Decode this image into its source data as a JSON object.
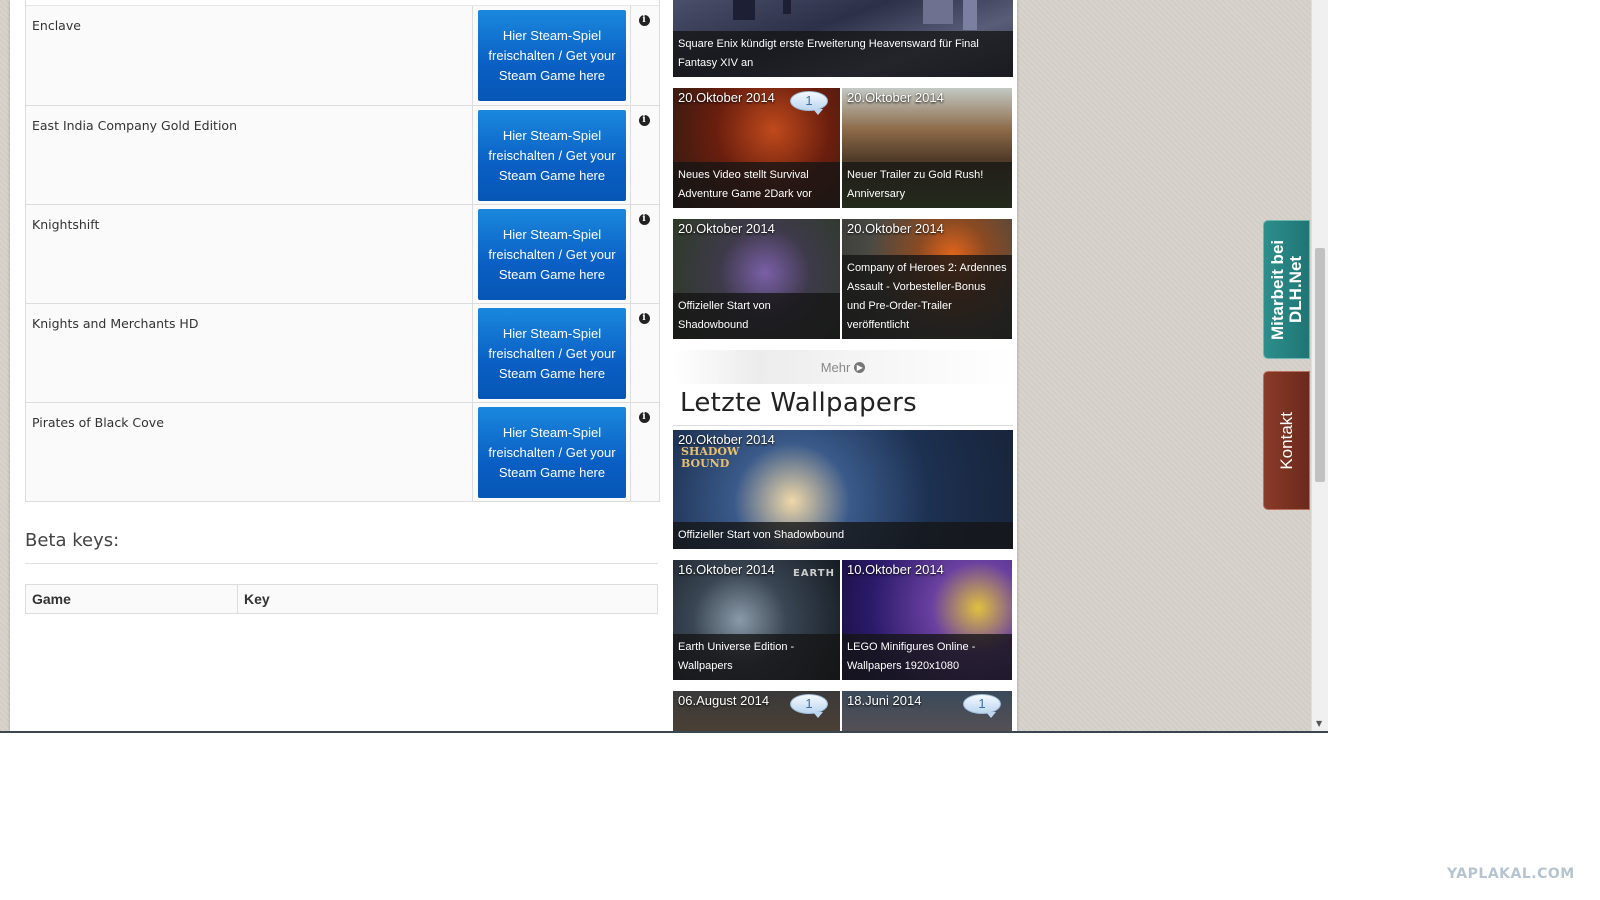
{
  "steam_rows": [
    {
      "name": "Enclave",
      "button": "Hier Steam-Spiel freischalten / Get your Steam Game here"
    },
    {
      "name": "East India Company Gold Edition",
      "button": "Hier Steam-Spiel freischalten / Get your Steam Game here"
    },
    {
      "name": "Knightshift",
      "button": "Hier Steam-Spiel freischalten / Get your Steam Game here"
    },
    {
      "name": "Knights and Merchants HD",
      "button": "Hier Steam-Spiel freischalten / Get your Steam Game here"
    },
    {
      "name": "Pirates of Black Cove",
      "button": "Hier Steam-Spiel freischalten / Get your Steam Game here"
    }
  ],
  "beta": {
    "title": "Beta keys:",
    "col_game": "Game",
    "col_key": "Key"
  },
  "news": {
    "top_caption": "Square Enix kündigt erste Erweiterung Heavensward für Final Fantasy XIV an",
    "tiles": [
      {
        "date": "20.Oktober 2014",
        "caption": "Neues Video stellt Survival Adventure Game 2Dark vor",
        "comments": "1"
      },
      {
        "date": "20.Oktober 2014",
        "caption": "Neuer Trailer zu Gold Rush! Anniversary"
      },
      {
        "date": "20.Oktober 2014",
        "caption": "Offizieller Start von Shadowbound"
      },
      {
        "date": "20.Oktober 2014",
        "caption": "Company of Heroes 2: Ardennes Assault - Vorbesteller-Bonus und Pre-Order-Trailer veröffentlicht"
      }
    ],
    "mehr": "Mehr"
  },
  "wallpapers": {
    "title": "Letzte Wallpapers",
    "featured": {
      "date": "20.Oktober 2014",
      "caption": "Offizieller Start von Shadowbound",
      "logo": "SHADOW BOUND"
    },
    "tiles": [
      {
        "date": "16.Oktober 2014",
        "caption": "Earth Universe Edition - Wallpapers",
        "logo": "EARTH"
      },
      {
        "date": "10.Oktober 2014",
        "caption": "LEGO Minifigures Online - Wallpapers 1920x1080"
      },
      {
        "date": "06.August 2014",
        "comments": "1"
      },
      {
        "date": "18.Juni 2014",
        "comments": "1"
      }
    ]
  },
  "side_tabs": {
    "mitarbeit": "Mitarbeit bei DLH.Net",
    "kontakt": "Kontakt"
  },
  "watermark": "YAPLAKAL.COM"
}
